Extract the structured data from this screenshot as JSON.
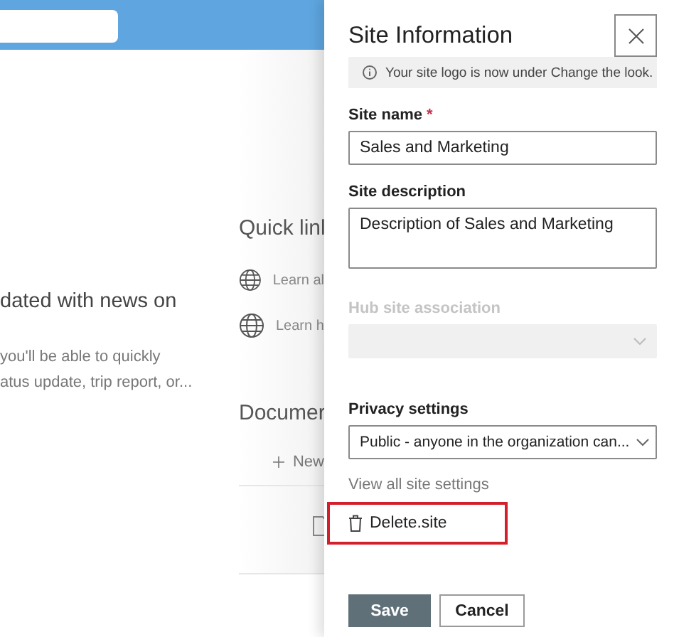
{
  "background_page": {
    "news_heading": "dated with news on",
    "news_text": [
      "you'll be able to quickly",
      "atus update, trip report, or..."
    ],
    "quick_links": {
      "title": "Quick linl",
      "items": [
        "Learn al",
        "Learn h"
      ]
    },
    "documents": {
      "title": "Documer",
      "new_button": "New"
    }
  },
  "panel": {
    "title": "Site Information",
    "info": "Your site logo is now under Change the look.",
    "fields": [
      {
        "kind": "text",
        "label": "Site name",
        "required_mark": "*",
        "value": "Sales and Marketing",
        "disabled": false
      },
      {
        "kind": "textarea",
        "label": "Site description",
        "value": "Description of Sales and Marketing",
        "disabled": false
      },
      {
        "kind": "dropdown",
        "label": "Hub site association",
        "disabled": true
      },
      {
        "kind": "dropdown",
        "label": "Privacy settings",
        "value": "Public - anyone in the organization can...",
        "disabled": false
      }
    ],
    "view_all_link": "View all site settings",
    "delete": {
      "label": "Delete.site",
      "highlighted": true
    },
    "buttons": [
      {
        "label": "Save",
        "kind": "primary"
      },
      {
        "label": "Cancel",
        "kind": "secondary"
      }
    ]
  }
}
